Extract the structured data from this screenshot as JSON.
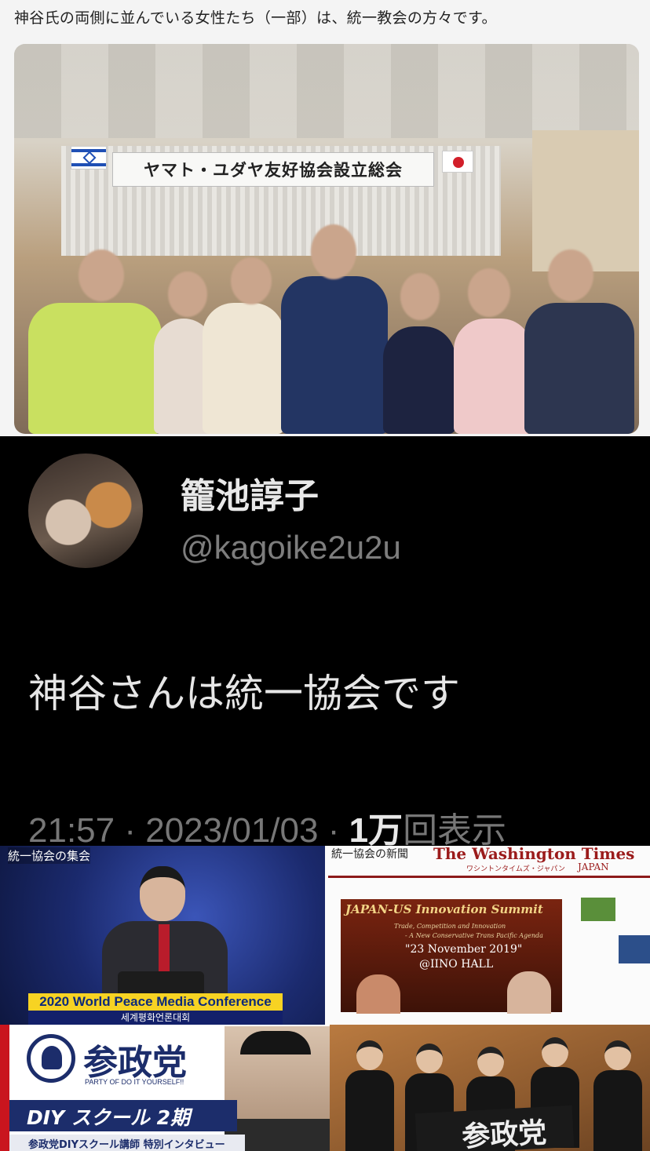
{
  "top": {
    "caption": "神谷氏の両側に並んでいる女性たち（一部）は、統一教会の方々です。",
    "banner_text": "ヤマト・ユダヤ友好協会設立総会"
  },
  "tweet": {
    "display_name": "籠池諄子",
    "handle": "@kagoike2u2u",
    "text": "神谷さんは統一協会です",
    "time": "21:57",
    "separator": "·",
    "date": "2023/01/03",
    "views_count": "1万",
    "views_label": "回表示"
  },
  "collage": {
    "conference": {
      "label": "統一協会の集会",
      "title": "2020 World Peace Media Conference",
      "subtitle": "세계평화언론대회"
    },
    "newspaper": {
      "label": "統一協会の新聞",
      "masthead": "The Washington Times",
      "masthead_sub": "ワシントンタイムズ・ジャパン",
      "masthead_japan": "JAPAN",
      "summit_title": "JAPAN-US Innovation Summit",
      "summit_sub1": "Trade, Competition and Innovation",
      "summit_sub2": "- A New Conservative Trans Pacific Agenda",
      "summit_date": "\"23 November 2019\"",
      "summit_venue": "@IINO HALL"
    },
    "diy": {
      "brand": "参政党",
      "tagline": "PARTY OF DO IT YOURSELF!!",
      "program": "DIY スクール 2期",
      "strip": "参政党DIYスクール講師 特別インタビュー"
    },
    "group": {
      "banner": "参政党"
    }
  }
}
